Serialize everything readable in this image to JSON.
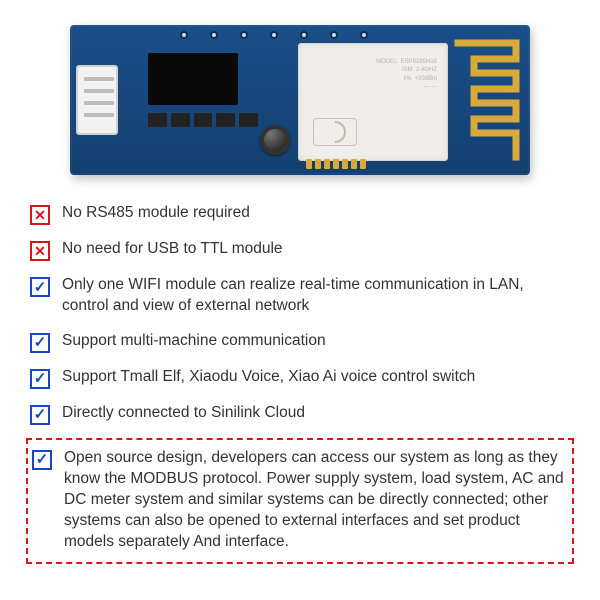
{
  "product_image": {
    "alt": "Blue WiFi PCB module with ESP8285 shielded chip, white JST connector, black voltage regulator, tactile button, and PCB trace antenna",
    "shield_marking": "MODEL  ESP8285H16\nISM  2.4GHZ\nPA  +20dBm\n--- ---"
  },
  "features": [
    {
      "icon": "x",
      "text": "No RS485 module required"
    },
    {
      "icon": "x",
      "text": "No need for USB to TTL module"
    },
    {
      "icon": "check",
      "text": "Only one WIFI module can realize real-time communication in LAN, control and view of external network"
    },
    {
      "icon": "check",
      "text": "Support multi-machine communication"
    },
    {
      "icon": "check",
      "text": "Support Tmall Elf, Xiaodu Voice, Xiao Ai voice control switch"
    },
    {
      "icon": "check",
      "text": "Directly connected to Sinilink Cloud"
    }
  ],
  "highlight": {
    "icon": "check",
    "text": "Open source design, developers can access our system as long as they know the MODBUS protocol. Power supply system, load system, AC and DC meter system and similar systems can be directly connected; other systems can also be opened to external interfaces and set product models separately And interface."
  }
}
